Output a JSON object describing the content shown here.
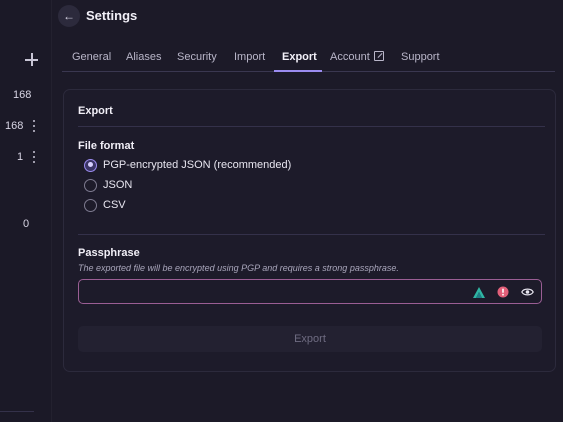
{
  "sidebar": {
    "counts": [
      "168",
      "168",
      "1",
      "0"
    ]
  },
  "header": {
    "title": "Settings",
    "back_glyph": "←"
  },
  "tabs": [
    {
      "label": "General",
      "active": false
    },
    {
      "label": "Aliases",
      "active": false
    },
    {
      "label": "Security",
      "active": false
    },
    {
      "label": "Import",
      "active": false
    },
    {
      "label": "Export",
      "active": true
    },
    {
      "label": "Account",
      "active": false,
      "external": true
    },
    {
      "label": "Support",
      "active": false
    }
  ],
  "export": {
    "title": "Export",
    "file_format_label": "File format",
    "formats": [
      {
        "label": "PGP-encrypted JSON (recommended)",
        "checked": true
      },
      {
        "label": "JSON",
        "checked": false
      },
      {
        "label": "CSV",
        "checked": false
      }
    ],
    "passphrase_label": "Passphrase",
    "passphrase_hint": "The exported file will be encrypted using PGP and requires a strong passphrase.",
    "passphrase_value": "",
    "button_label": "Export"
  },
  "colors": {
    "accent": "#9b8cf0",
    "input_border": "#9a5e94",
    "warning": "#e2607a",
    "teal": "#2fb5a3"
  },
  "icons": {
    "back": "arrow-left-icon",
    "add": "plus-icon",
    "menu": "kebab-icon",
    "external": "external-link-icon",
    "generator": "password-manager-icon",
    "warning": "alert-icon",
    "reveal": "eye-icon"
  }
}
